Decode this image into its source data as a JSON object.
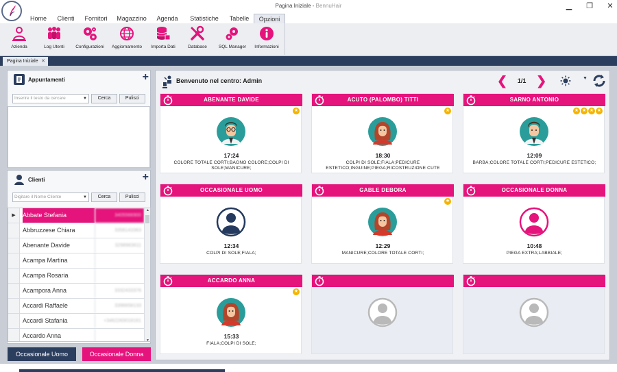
{
  "window": {
    "title": "Pagina Iniziale",
    "subtitle": "BennuHair",
    "minimize": "▁",
    "restore": "❐",
    "close": "✕"
  },
  "menu": {
    "tabs": [
      {
        "label": "Home"
      },
      {
        "label": "Clienti"
      },
      {
        "label": "Fornitori"
      },
      {
        "label": "Magazzino"
      },
      {
        "label": "Agenda"
      },
      {
        "label": "Statistiche"
      },
      {
        "label": "Tabelle"
      },
      {
        "label": "Opzioni",
        "active": true
      }
    ]
  },
  "ribbon": {
    "buttons": [
      {
        "label": "Azienda",
        "icon": "company-icon"
      },
      {
        "label": "Log Utenti",
        "icon": "users-log-icon"
      },
      {
        "label": "Configurazioni",
        "icon": "gears-icon"
      },
      {
        "label": "Aggiornamento",
        "icon": "globe-update-icon"
      },
      {
        "label": "Importa Dati",
        "icon": "database-import-icon"
      },
      {
        "label": "Database",
        "icon": "tools-icon"
      },
      {
        "label": "SQL Manager",
        "icon": "sql-gears-icon"
      },
      {
        "label": "Informazioni",
        "icon": "info-icon"
      }
    ]
  },
  "doc_tab": {
    "label": "Pagina Iniziale",
    "close": "✕"
  },
  "appointments": {
    "title": "Appuntamenti",
    "add": "+",
    "placeholder": "Inserire il testo da cercare",
    "search_label": "Cerca",
    "clear_label": "Pulisci"
  },
  "clients": {
    "title": "Clienti",
    "add": "+",
    "placeholder": "Digitare il Nome Cliente",
    "search_label": "Cerca",
    "clear_label": "Pulisci",
    "rows": [
      {
        "name": "Abbate Stefania",
        "phone": "3405566900",
        "selected": true
      },
      {
        "name": "Abbruzzese Chiara",
        "phone": "3356143363"
      },
      {
        "name": "Abenante Davide",
        "phone": "3298983611"
      },
      {
        "name": "Acampa Martina",
        "phone": ""
      },
      {
        "name": "Acampa Rosaria",
        "phone": ""
      },
      {
        "name": "Acampora Anna",
        "phone": "3332433376"
      },
      {
        "name": "Accardi Raffaele",
        "phone": "3396658133"
      },
      {
        "name": "Accardi Stafania",
        "phone": "+3462283018161"
      },
      {
        "name": "Accardo Anna",
        "phone": ""
      }
    ]
  },
  "quick_buttons": {
    "male": "Occasionale Uomo",
    "female": "Occasionale Donna"
  },
  "main": {
    "title": "Benvenuto nel centro: Admin",
    "page": "1/1",
    "prev": "❮",
    "next": "❯"
  },
  "colors": {
    "accent": "#e5137c",
    "navy": "#2c3e5e",
    "star": "#f5b400"
  },
  "cards": [
    {
      "name": "ABENANTE DAVIDE",
      "time": "17:24",
      "services": "COLORE TOTALE CORTI;BAGNO COLORE;COLPI DI SOLE;MANICURE;",
      "stars": 1,
      "avatar": "man-glasses"
    },
    {
      "name": "ACUTO (PALOMBO) TITTI",
      "time": "18:30",
      "services": "COLPI DI SOLE;FIALA;PEDICURE ESTETICO;INGUINE;PIEGA;RICOSTRUZIONE CUTE",
      "stars": 1,
      "avatar": "woman"
    },
    {
      "name": "SARNO ANTONIO",
      "time": "12:09",
      "services": "BARBA;COLORE TOTALE CORTI;PEDICURE ESTETICO;",
      "stars": 4,
      "avatar": "man"
    },
    {
      "name": "OCCASIONALE UOMO",
      "time": "12:34",
      "services": "COLPI DI SOLE;FIALA;",
      "stars": 0,
      "avatar": "generic-male"
    },
    {
      "name": "GABLE DEBORA",
      "time": "12:29",
      "services": "MANICURE;COLORE TOTALE CORTI;",
      "stars": 1,
      "avatar": "woman"
    },
    {
      "name": "OCCASIONALE DONNA",
      "time": "10:48",
      "services": "PIEGA EXTRA;LABBIALE;",
      "stars": 0,
      "avatar": "generic-female"
    },
    {
      "name": "ACCARDO ANNA",
      "time": "15:33",
      "services": "FIALA;COLPI DI SOLE;",
      "stars": 1,
      "avatar": "woman"
    },
    {
      "name": "",
      "time": "",
      "services": "",
      "stars": 0,
      "avatar": "empty"
    },
    {
      "name": "",
      "time": "",
      "services": "",
      "stars": 0,
      "avatar": "empty"
    }
  ]
}
